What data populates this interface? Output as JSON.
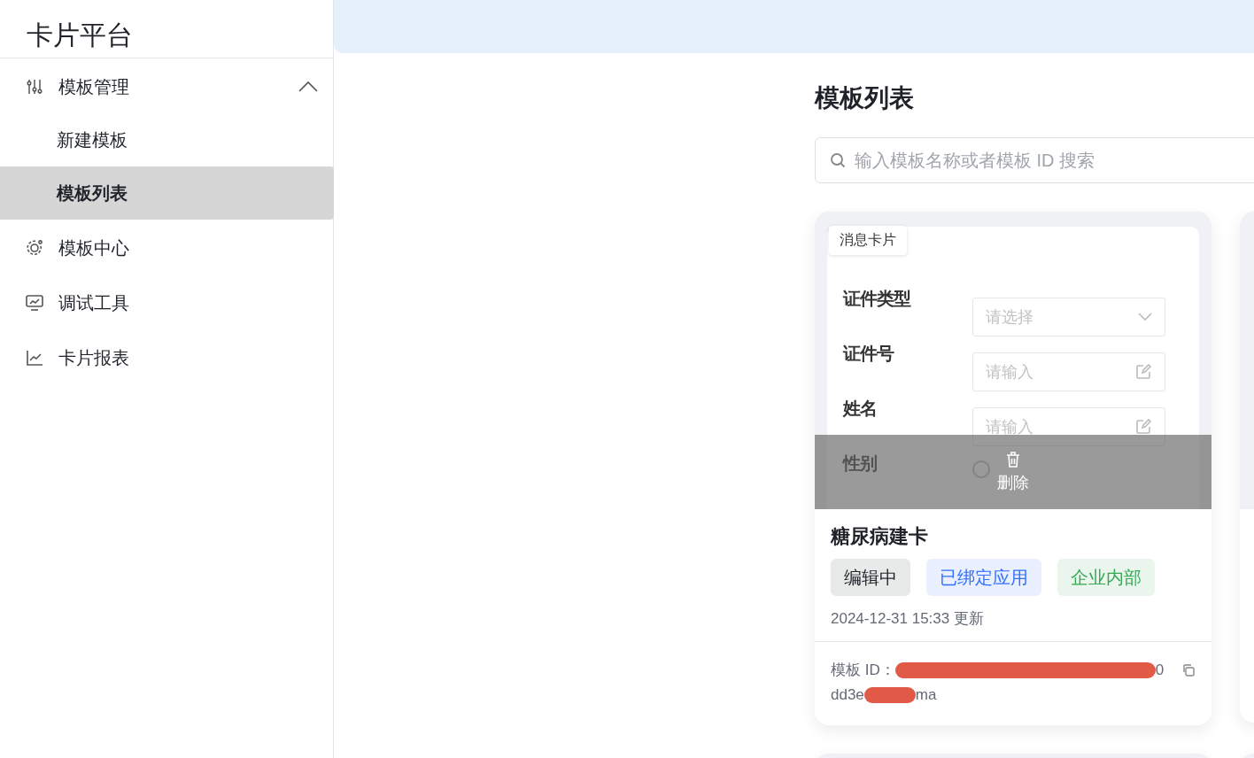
{
  "sidebar": {
    "title": "卡片平台",
    "items": [
      {
        "label": "模板管理",
        "expanded": true,
        "selected": false,
        "children": [
          {
            "label": "新建模板",
            "selected": false
          },
          {
            "label": "模板列表",
            "selected": true
          }
        ]
      },
      {
        "label": "模板中心",
        "selected": false
      },
      {
        "label": "调试工具",
        "selected": false
      },
      {
        "label": "卡片报表",
        "selected": false
      }
    ]
  },
  "main": {
    "heading": "模板列表",
    "search": {
      "placeholder": "输入模板名称或者模板 ID 搜索"
    },
    "cards": [
      {
        "type_tag": "消息卡片",
        "preview_fields": [
          {
            "kind": "select",
            "label": "证件类型",
            "placeholder": "请选择"
          },
          {
            "kind": "input",
            "label": "证件号",
            "placeholder": "请输入"
          },
          {
            "kind": "input",
            "label": "姓名",
            "placeholder": "请输入"
          },
          {
            "kind": "radio",
            "label": "性别",
            "selected": false
          }
        ],
        "overlay_action": "删除",
        "name": "糖尿病建卡",
        "tags": [
          {
            "text": "编辑中",
            "color": "#1f2329"
          },
          {
            "text": "已绑定应用",
            "color": "#3370ff"
          },
          {
            "text": "企业内部",
            "color": "#34a853"
          }
        ],
        "updated": "2024-12-31 15:33 更新",
        "id_label": "模板 ID：",
        "id_lines": [
          [
            {
              "kind": "redaction"
            },
            {
              "kind": "text",
              "text": "0"
            }
          ],
          [
            {
              "kind": "text",
              "text": "dd3e"
            },
            {
              "kind": "redaction"
            },
            {
              "kind": "text",
              "text": "ma"
            }
          ]
        ]
      }
    ]
  }
}
